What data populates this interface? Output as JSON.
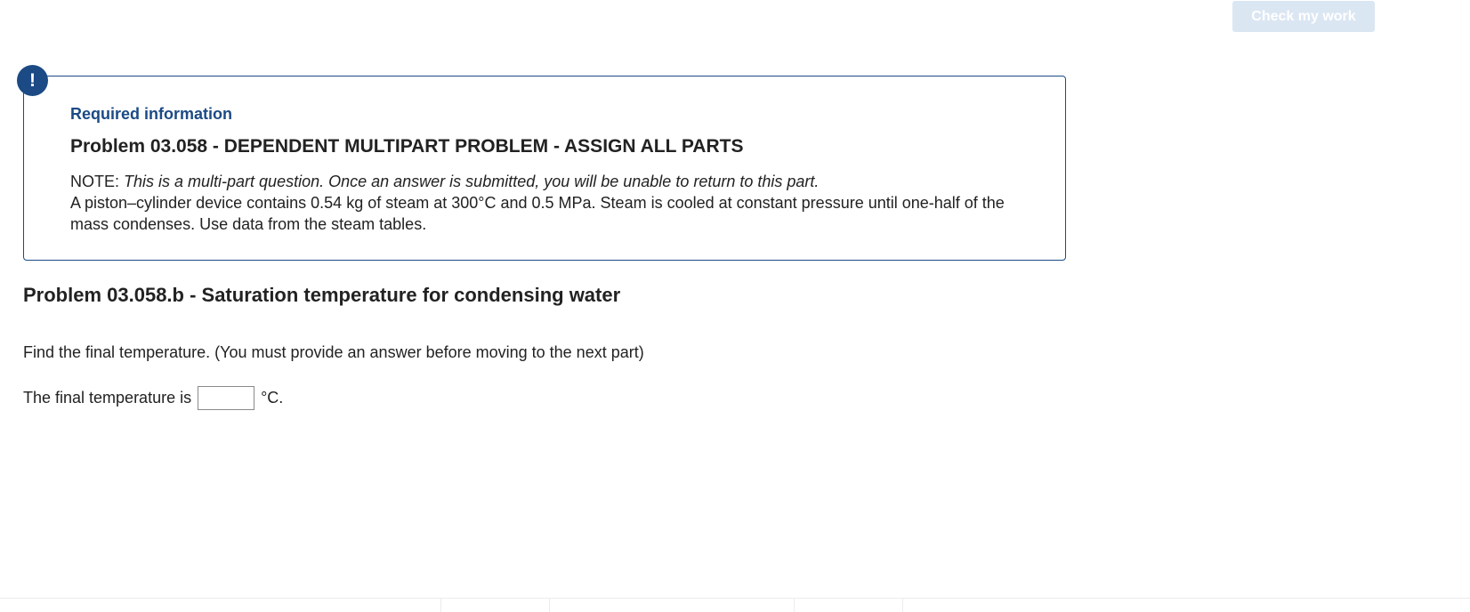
{
  "toolbar": {
    "check_label": "Check my work"
  },
  "alert": {
    "icon_glyph": "!"
  },
  "required": {
    "label": "Required information",
    "problem_title": "Problem 03.058 - DEPENDENT MULTIPART PROBLEM - ASSIGN ALL PARTS",
    "note_prefix": "NOTE: ",
    "note_italic": "This is a multi-part question. Once an answer is submitted, you will be unable to return to this part.",
    "description": "A piston–cylinder device contains 0.54 kg of steam at 300°C and 0.5 MPa. Steam is cooled at constant pressure until one-half of the mass condenses. Use data from the steam tables."
  },
  "part": {
    "title": "Problem 03.058.b - Saturation temperature for condensing water",
    "instruction": "Find the final temperature. (You must provide an answer before moving to the next part)",
    "answer_prefix": "The final temperature is",
    "answer_value": "",
    "answer_unit": "°C."
  }
}
